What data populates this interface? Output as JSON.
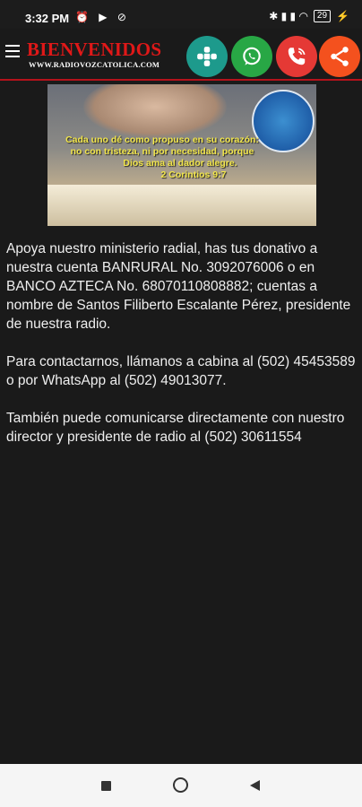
{
  "status_bar": {
    "time": "3:32 PM",
    "indicators": "⏰ ▶ ⊘",
    "right_icons": "✱ ▮ ▮ ◠",
    "battery": "29"
  },
  "header": {
    "title": "BIENVENIDOS",
    "subtitle": "WWW.RADIOVOZCATOLICA.COM",
    "buttons": {
      "medical": {
        "icon": "medical-app-icon",
        "color": "#1d9a8c"
      },
      "whatsapp": {
        "icon": "whatsapp-icon",
        "color": "#28a745"
      },
      "call": {
        "icon": "phone-icon",
        "color": "#e53935"
      },
      "share": {
        "icon": "share-icon",
        "color": "#f4511e"
      }
    }
  },
  "banner": {
    "verse_lines": [
      "Cada uno dé como propuso en su corazón:",
      "no con tristeza, ni por necesidad, porque",
      "Dios ama al dador alegre.",
      "2 Corintios 9:7"
    ]
  },
  "body": {
    "paragraph_1": "Apoya nuestro ministerio radial, has tus donativo a nuestra cuenta BANRURAL No. 3092076006 o en BANCO AZTECA No. 68070110808882; cuentas a nombre de Santos Filiberto Escalante Pérez, presidente de nuestra radio.",
    "paragraph_2": "Para contactarnos, llámanos a cabina al (502) 45453589 o por WhatsApp al (502) 49013077.",
    "paragraph_3": "También puede comunicarse directamente con nuestro director y presidente de radio al (502) 30611554"
  },
  "navbar": {
    "recent": "recent-apps-icon",
    "home": "home-icon",
    "back": "back-icon"
  }
}
